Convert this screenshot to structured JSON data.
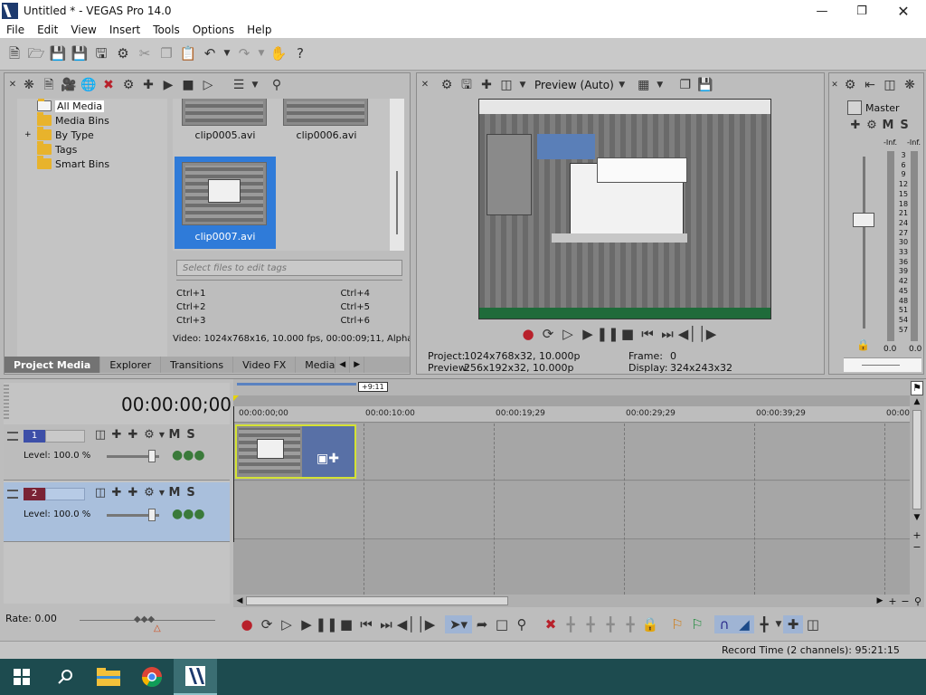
{
  "window": {
    "title": "Untitled * - VEGAS Pro 14.0"
  },
  "menu": [
    "File",
    "Edit",
    "View",
    "Insert",
    "Tools",
    "Options",
    "Help"
  ],
  "media": {
    "tree": [
      {
        "label": "All Media",
        "selected": true
      },
      {
        "label": "Media Bins"
      },
      {
        "label": "By Type",
        "expander": "+"
      },
      {
        "label": "Tags"
      },
      {
        "label": "Smart Bins"
      }
    ],
    "clips": [
      {
        "name": "clip0005.avi",
        "selected": false
      },
      {
        "name": "clip0006.avi",
        "selected": false
      },
      {
        "name": "clip0007.avi",
        "selected": true
      }
    ],
    "tags_placeholder": "Select files to edit tags",
    "shortcuts": [
      "Ctrl+1",
      "Ctrl+4",
      "Ctrl+2",
      "Ctrl+5",
      "Ctrl+3",
      "Ctrl+6"
    ],
    "status": "Video: 1024x768x16, 10.000 fps, 00:00:09;11, Alpha",
    "tabs": [
      "Project Media",
      "Explorer",
      "Transitions",
      "Video FX",
      "Media G"
    ]
  },
  "preview": {
    "quality": "Preview (Auto)",
    "project_label": "Project:",
    "project_value": "1024x768x32, 10.000p",
    "preview_label": "Preview:",
    "preview_value": "256x192x32, 10.000p",
    "frame_label": "Frame:",
    "frame_value": "0",
    "display_label": "Display:",
    "display_value": "324x243x32"
  },
  "master": {
    "label": "Master",
    "m": "M",
    "s": "S",
    "inf_left": "-Inf.",
    "inf_right": "-Inf.",
    "scale": [
      "3",
      "6",
      "9",
      "12",
      "15",
      "18",
      "21",
      "24",
      "27",
      "30",
      "33",
      "36",
      "39",
      "42",
      "45",
      "48",
      "51",
      "54",
      "57"
    ],
    "bottom_left": "0.0",
    "bottom_right": "0.0"
  },
  "timeline": {
    "timecode": "00:00:00;00",
    "loop_tag": "+9:11",
    "ruler": [
      "00:00:00;00",
      "00:00:10:00",
      "00:00:19;29",
      "00:00:29;29",
      "00:00:39;29",
      "00:00"
    ],
    "tracks": [
      {
        "number": "1",
        "level": "Level: 100.0 %",
        "m": "M",
        "s": "S"
      },
      {
        "number": "2",
        "level": "Level: 100.0 %",
        "m": "M",
        "s": "S"
      }
    ],
    "rate": "Rate: 0.00",
    "record_time": "Record Time (2 channels): 95:21:15"
  }
}
